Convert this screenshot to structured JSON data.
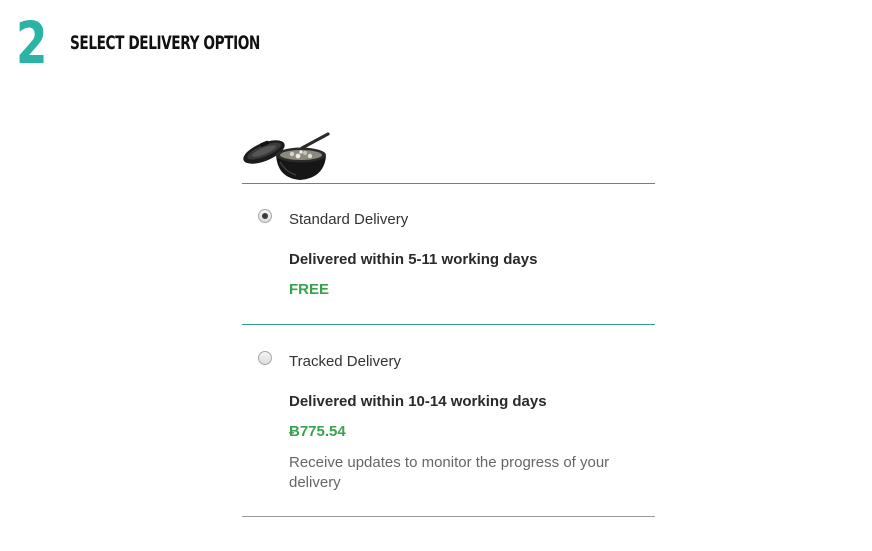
{
  "step": {
    "number": "2",
    "title": "SELECT DELIVERY OPTION"
  },
  "product": {
    "image_icon": "wok-with-lid-and-spatula-icon"
  },
  "delivery_options": [
    {
      "label": "Standard Delivery",
      "timeframe": "Delivered within 5-11 working days",
      "price": "FREE",
      "selected": true
    },
    {
      "label": "Tracked Delivery",
      "timeframe": "Delivered within 10-14 working days",
      "price": "Ƀ775.54",
      "description": "Receive updates to monitor the progress of your delivery",
      "selected": false
    }
  ],
  "colors": {
    "accent": "#2bb3a6",
    "divider": "#2f9f95",
    "price": "#3aa24e"
  }
}
